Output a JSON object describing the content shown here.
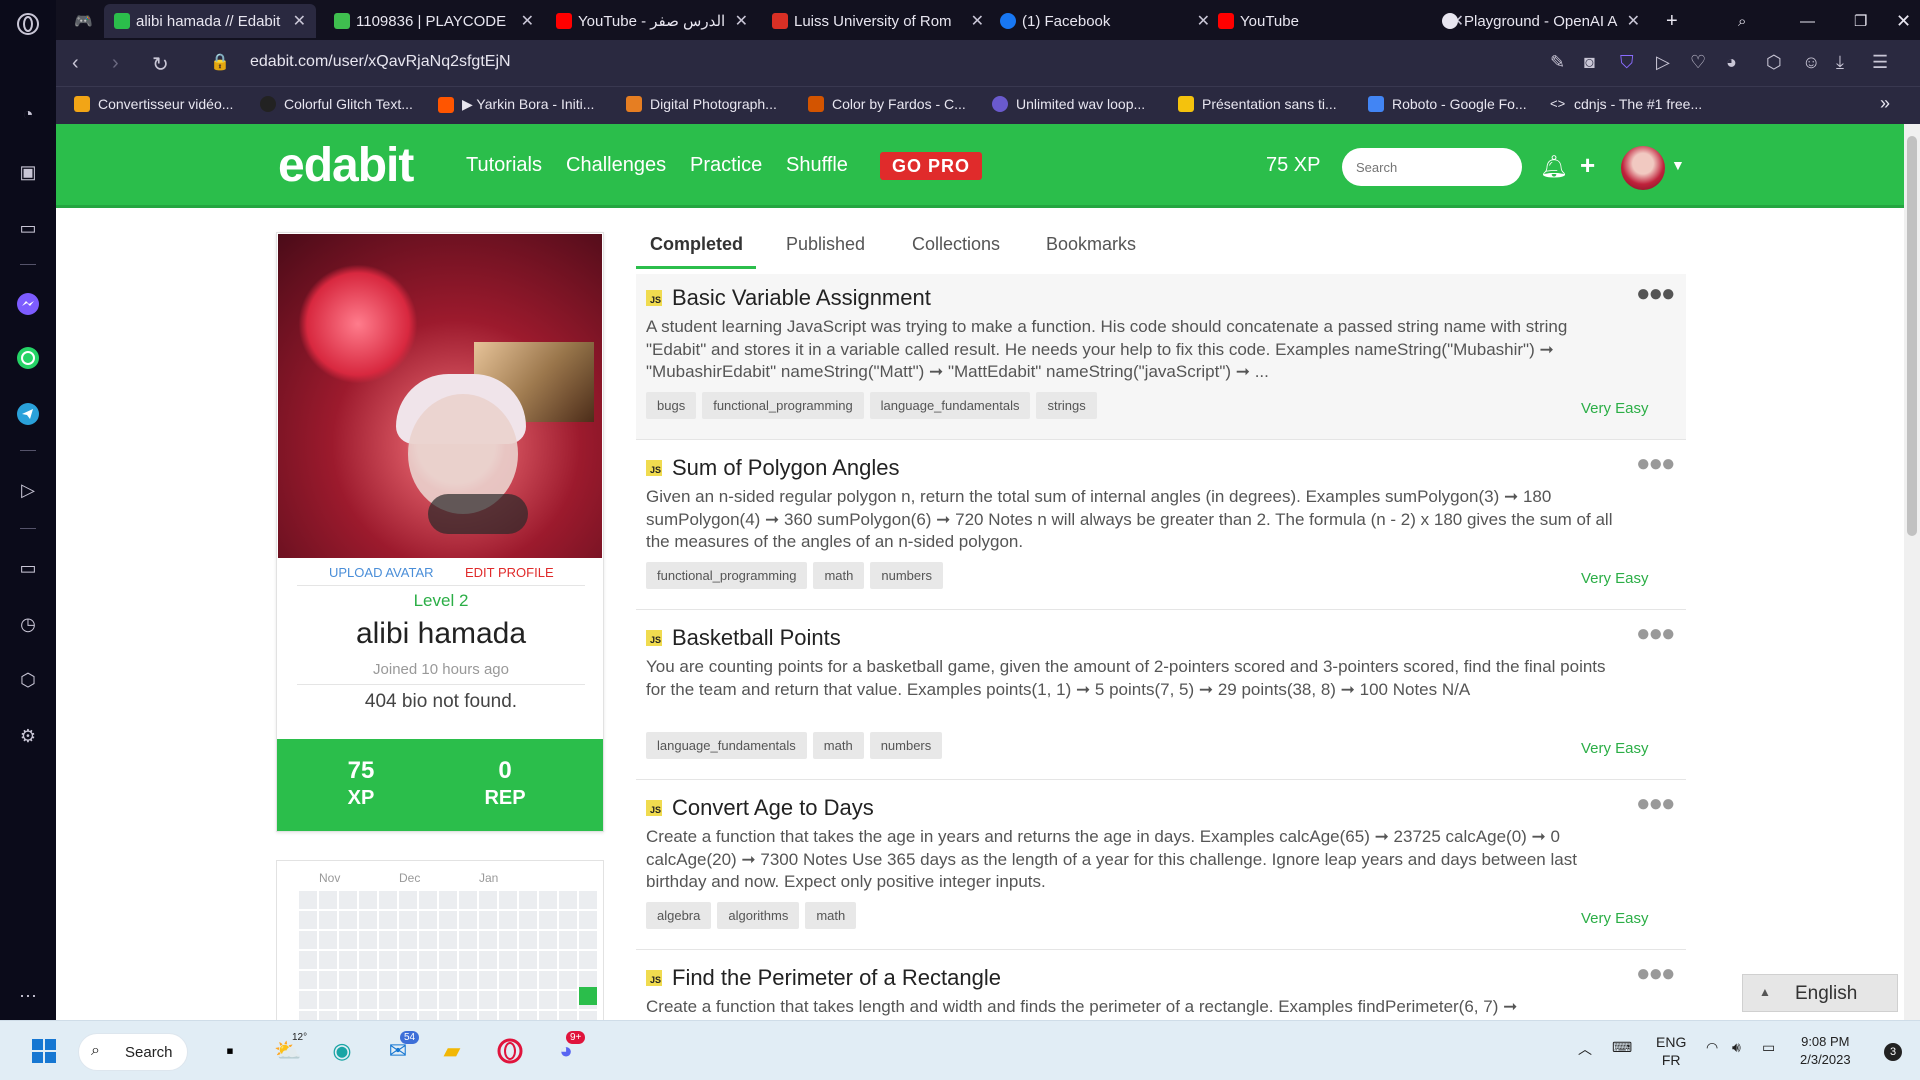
{
  "browser": {
    "tabs": [
      {
        "title": "alibi hamada // Edabit",
        "active": true,
        "icon": "edabit-favicon",
        "color": "#2bbe4b"
      },
      {
        "title": "1109836 | PLAYCODE",
        "icon": "playcode-favicon",
        "color": "#3fbf4f"
      },
      {
        "title": "YouTube - الدرس صفر",
        "icon": "youtube-favicon",
        "color": "#ff0000"
      },
      {
        "title": "Luiss University of Rom",
        "icon": "gmail-favicon",
        "color": "#d93025"
      },
      {
        "title": "(1) Facebook",
        "icon": "facebook-favicon",
        "color": "#1877f2"
      },
      {
        "title": "YouTube",
        "icon": "youtube-favicon",
        "color": "#ff0000"
      },
      {
        "title": "Playground - OpenAI A",
        "icon": "openai-favicon",
        "color": "#e8e6f0"
      }
    ],
    "url": "edabit.com/user/xQavRjaNq2sfgtEjN",
    "bookmarks": [
      {
        "label": "Convertisseur vidéo...",
        "color": "#f2a516"
      },
      {
        "label": "Colorful Glitch Text...",
        "color": "#222222"
      },
      {
        "label": "▶ Yarkin Bora - Initi...",
        "color": "#ff5500"
      },
      {
        "label": "Digital Photograph...",
        "color": "#e67e22"
      },
      {
        "label": "Color by Fardos - C...",
        "color": "#d35400"
      },
      {
        "label": "Unlimited wav loop...",
        "color": "#6a5acd"
      },
      {
        "label": "Présentation sans ti...",
        "color": "#f4c20d"
      },
      {
        "label": "Roboto - Google Fo...",
        "color": "#4285f4"
      },
      {
        "label": "cdnjs - The #1 free...",
        "color": "#e8e6f0"
      }
    ]
  },
  "site": {
    "logo": "edabit",
    "nav": [
      "Tutorials",
      "Challenges",
      "Practice",
      "Shuffle"
    ],
    "gopro": "GO PRO",
    "xp": "75 XP",
    "search_placeholder": "Search",
    "brand_color": "#2bbe4b"
  },
  "profile": {
    "upload_avatar": "UPLOAD AVATAR",
    "edit_profile": "EDIT PROFILE",
    "level": "Level 2",
    "name": "alibi hamada",
    "joined": "Joined 10 hours ago",
    "bio": "404 bio not found.",
    "xp_value": "75",
    "xp_label": "XP",
    "rep_value": "0",
    "rep_label": "REP"
  },
  "activity": {
    "months": [
      "Nov",
      "Dec",
      "Jan"
    ]
  },
  "content_tabs": [
    "Completed",
    "Published",
    "Collections",
    "Bookmarks"
  ],
  "challenges": [
    {
      "lang": "JS",
      "title": "Basic Variable Assignment",
      "description": "A student learning JavaScript was trying to make a function. His code should concatenate a passed string name with string \"Edabit\" and stores it in a variable called result. He needs your help to fix this code. Examples nameString(\"Mubashir\") ➞ \"MubashirEdabit\" nameString(\"Matt\") ➞ \"MattEdabit\" nameString(\"javaScript\") ➞ ...",
      "tags": [
        "bugs",
        "functional_programming",
        "language_fundamentals",
        "strings"
      ],
      "difficulty": "Very Easy"
    },
    {
      "lang": "JS",
      "title": "Sum of Polygon Angles",
      "description": "Given an n-sided regular polygon n, return the total sum of internal angles (in degrees). Examples sumPolygon(3) ➞ 180 sumPolygon(4) ➞ 360 sumPolygon(6) ➞ 720 Notes n will always be greater than 2. The formula (n - 2) x 180 gives the sum of all the measures of the angles of an n-sided polygon.",
      "tags": [
        "functional_programming",
        "math",
        "numbers"
      ],
      "difficulty": "Very Easy"
    },
    {
      "lang": "JS",
      "title": "Basketball Points",
      "description": "You are counting points for a basketball game, given the amount of 2-pointers scored and 3-pointers scored, find the final points for the team and return that value. Examples points(1, 1) ➞ 5 points(7, 5) ➞ 29 points(38, 8) ➞ 100 Notes N/A",
      "tags": [
        "language_fundamentals",
        "math",
        "numbers"
      ],
      "difficulty": "Very Easy"
    },
    {
      "lang": "JS",
      "title": "Convert Age to Days",
      "description": "Create a function that takes the age in years and returns the age in days. Examples calcAge(65) ➞ 23725 calcAge(0) ➞ 0 calcAge(20) ➞ 7300 Notes Use 365 days as the length of a year for this challenge. Ignore leap years and days between last birthday and now. Expect only positive integer inputs.",
      "tags": [
        "algebra",
        "algorithms",
        "math"
      ],
      "difficulty": "Very Easy"
    },
    {
      "lang": "JS",
      "title": "Find the Perimeter of a Rectangle",
      "description": "Create a function that takes length and width and finds the perimeter of a rectangle. Examples findPerimeter(6, 7) ➞",
      "tags": [],
      "difficulty": ""
    }
  ],
  "language": "English",
  "taskbar": {
    "search": "Search",
    "weather": "12°",
    "mail_badge": "54",
    "discord_badge": "9+",
    "lang_top": "ENG",
    "lang_bottom": "FR",
    "time": "9:08 PM",
    "date": "2/3/2023",
    "notifications": "3"
  }
}
